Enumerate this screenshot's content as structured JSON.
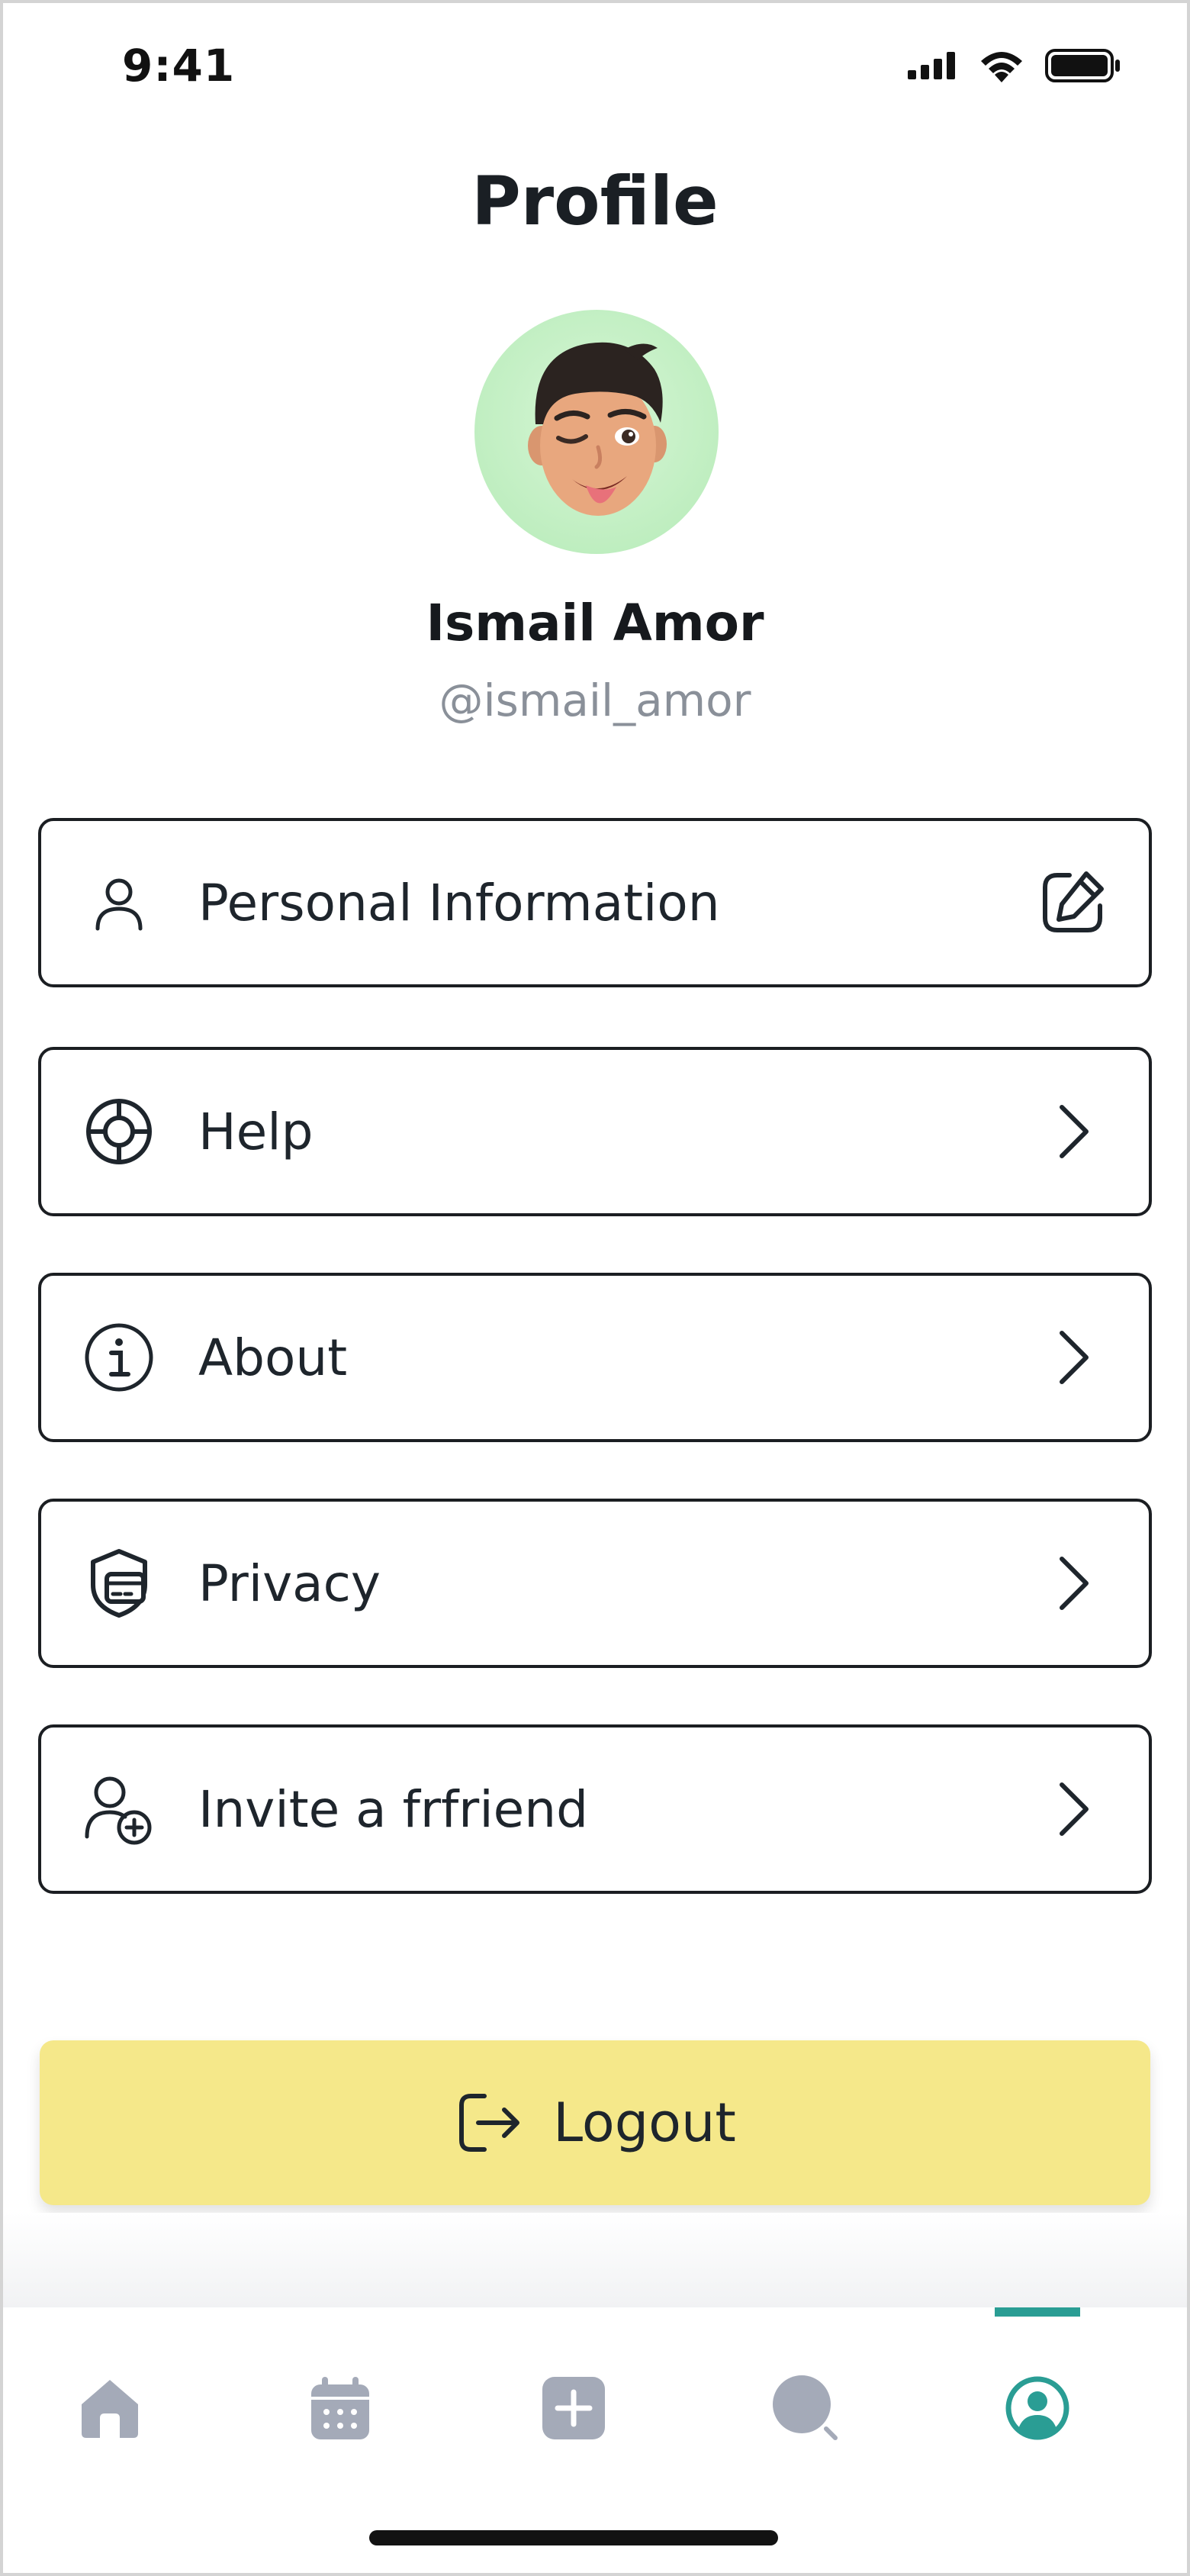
{
  "status_bar": {
    "time": "9:41"
  },
  "page": {
    "title": "Profile"
  },
  "profile": {
    "name": "Ismail Amor",
    "handle": "@ismail_amor"
  },
  "menu": {
    "items": [
      {
        "label": "Personal Information",
        "icon": "user-icon",
        "trailing": "edit-icon"
      },
      {
        "label": "Help",
        "icon": "lifebuoy-icon",
        "trailing": "chevron-right-icon"
      },
      {
        "label": "About",
        "icon": "info-icon",
        "trailing": "chevron-right-icon"
      },
      {
        "label": "Privacy",
        "icon": "privacy-shield-icon",
        "trailing": "chevron-right-icon"
      },
      {
        "label": "Invite a frfriend",
        "icon": "user-add-icon",
        "trailing": "chevron-right-icon"
      }
    ]
  },
  "logout": {
    "label": "Logout",
    "icon": "logout-icon"
  },
  "tab_bar": {
    "tabs": [
      "home-icon",
      "calendar-icon",
      "add-icon",
      "search-icon",
      "profile-icon"
    ],
    "active": "profile-icon"
  },
  "colors": {
    "accent": "#2a9d94",
    "logout_bg": "#f5e88a",
    "avatar_bg": "#bfeec0",
    "inactive_tab": "#a4aab8",
    "handle_text": "#8a9099"
  }
}
